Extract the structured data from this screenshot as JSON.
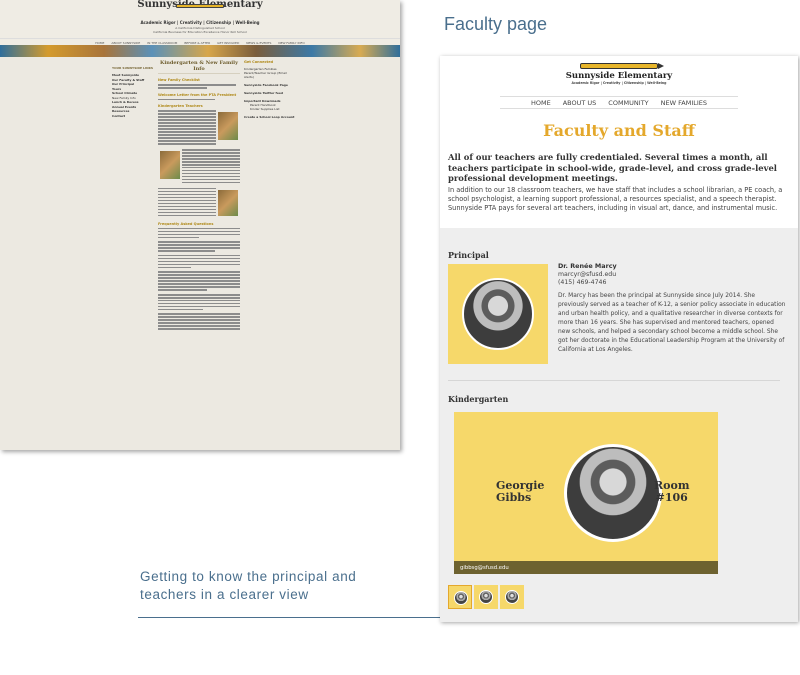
{
  "captions": {
    "faculty_page": "Faculty page",
    "bottom": "Getting to know the principal and teachers in a clearer view"
  },
  "old_site": {
    "school_name": "Sunnyside Elementary",
    "tagline": "Academic Rigor | Creativity | Citizenship | Well-Being",
    "subtitle": "A California Distinguished School",
    "subtitle2": "California Business for Education Excellence Honor Roll School",
    "nav": [
      "HOME",
      "ABOUT SUNNYSIDE",
      "IN THE CLASSROOM",
      "BEFORE & AFTER",
      "GET INVOLVED",
      "NEWS & EVENTS",
      "NEW FAMILY INFO"
    ],
    "left_heading": "YOUR SUNNYSIDE LINKS",
    "left_links": [
      "Meet Sunnyside",
      "Our Faculty & Staff",
      "Our Principal",
      "Tours",
      "School Climate",
      "New Family Info",
      "Lunch & Recess",
      "Annual Events",
      "Resources",
      "Contact"
    ],
    "main_heading": "Kindergarten & New Family Info",
    "main_sub1": "New Family Checklist",
    "main_sub2": "Welcome Letter from the PTA President",
    "main_sub3": "Kindergarten Teachers",
    "main_sub4": "Frequently Asked Questions",
    "right_heading": "Get Connected",
    "right_items": [
      "Kindergarten Families Parent/Teacher Group (Email Alerts)",
      "Sunnyside Facebook Page",
      "Sunnyside Twitter feed",
      "Important Downloads",
      "Parent Handbook",
      "Kinder Supplies List",
      "Create a School Loop Account"
    ]
  },
  "faculty": {
    "school_name": "Sunnyside Elementary",
    "motto": "Academic Rigor | Creativity | Citizenship | Well-Being",
    "nav": [
      "HOME",
      "ABOUT US",
      "COMMUNITY",
      "NEW FAMILIES"
    ],
    "title": "Faculty and Staff",
    "lead": "All of our teachers are fully credentialed. Several times a month, all teachers participate in school-wide, grade-level, and cross grade-level professional development meetings.",
    "intro": "In addition to our 18 classroom teachers, we have staff that includes a school librarian, a PE coach, a school psychologist, a learning support professional, a resources specialist, and a speech therapist. Sunnyside PTA pays for several art teachers, including in visual art, dance, and instrumental music.",
    "principal": {
      "section": "Principal",
      "name": "Dr. Renée Marcy",
      "email": "marcyr@sfusd.edu",
      "phone": "(415) 469-4746",
      "bio": "Dr. Marcy has been the principal at Sunnyside since July 2014. She previously served as a teacher of K-12, a senior policy associate in education and urban health policy, and a qualitative researcher in diverse contexts for more than 16 years. She has supervised and mentored teachers, opened new schools, and helped a secondary school become a middle school. She got her doctorate in the Educational Leadership Program at the University of California at Los Angeles."
    },
    "kindergarten": {
      "section": "Kindergarten",
      "first_name": "Georgie",
      "last_name": "Gibbs",
      "room_label": "Room",
      "room_number": "#106",
      "email": "gibbsg@sfusd.edu"
    },
    "accent_color": "#e4a82c",
    "card_color": "#f6d86a"
  }
}
